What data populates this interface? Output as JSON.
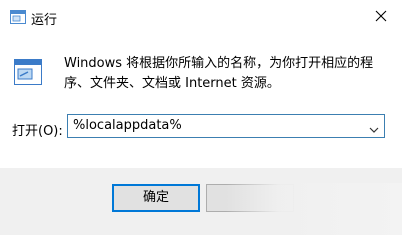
{
  "window": {
    "title": "运行",
    "icons": {
      "app": "run-icon",
      "close": "close-icon",
      "dropdown": "chevron-down-icon"
    }
  },
  "main": {
    "description": "Windows 将根据你所输入的名称，为你打开相应的程序、文件夹、文档或 Internet 资源。",
    "open_label": "打开(O):",
    "input_value": "%localappdata%"
  },
  "footer": {
    "ok_label": "确定"
  },
  "colors": {
    "accent": "#0078d7",
    "input_border": "#3c7fb1",
    "footer_bg": "#f0f0f0"
  }
}
